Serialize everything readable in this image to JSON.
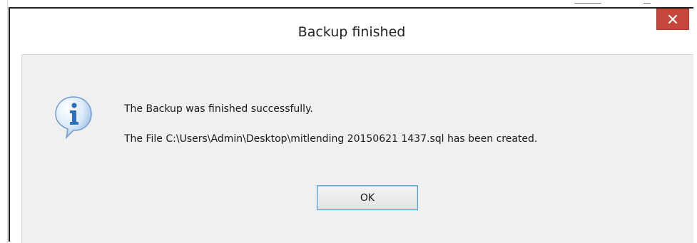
{
  "dialog": {
    "title": "Backup finished",
    "icon": "info-icon",
    "message_line_1": "The Backup was finished successfully.",
    "message_line_2": "The File C:\\Users\\Admin\\Desktop\\mitlending 20150621 1437.sql has been created.",
    "ok_label": "OK",
    "close_icon": "close-icon"
  },
  "colors": {
    "close_button": "#c7463b",
    "content_background": "#f0f0f0",
    "ok_border": "#4a9ad6",
    "info_icon_blue": "#3a7bc8"
  }
}
